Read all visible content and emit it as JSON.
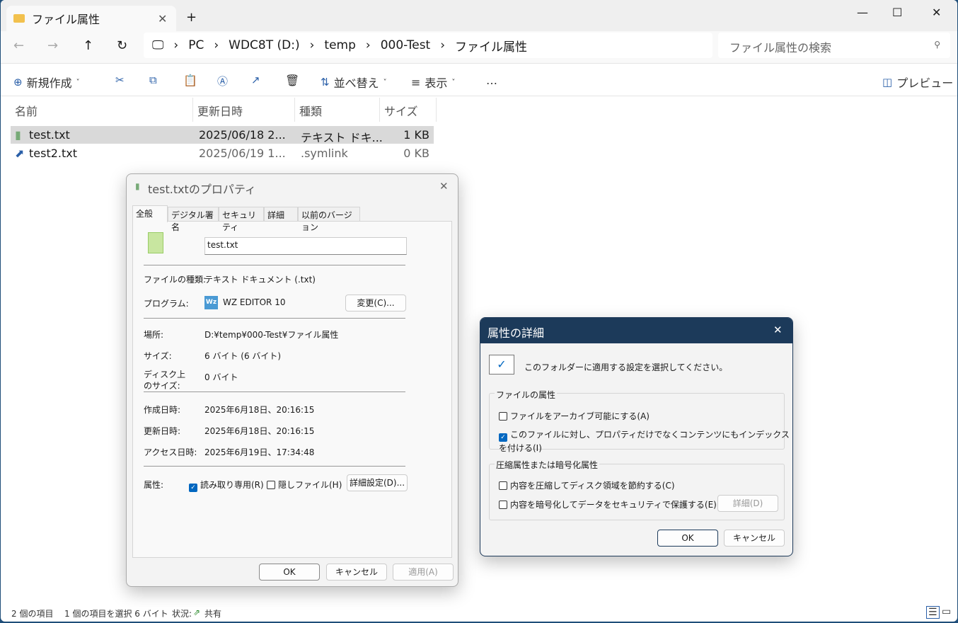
{
  "window": {
    "tab_title": "ファイル属性",
    "new_tab": "+"
  },
  "nav": {
    "back": "←",
    "forward": "→",
    "up": "↑",
    "refresh": "↻",
    "crumbs": [
      "PC",
      "WDC8T (D:)",
      "temp",
      "000-Test",
      "ファイル属性"
    ],
    "search_placeholder": "ファイル属性の検索"
  },
  "toolbar": {
    "new": "新規作成",
    "sort": "並べ替え",
    "view": "表示",
    "more": "…",
    "preview": "プレビュー"
  },
  "columns": [
    "名前",
    "更新日時",
    "種類",
    "サイズ"
  ],
  "files": [
    {
      "name": "test.txt",
      "date": "2025/06/18 2...",
      "type": "テキスト ドキ...",
      "size": "1 KB"
    },
    {
      "name": "test2.txt",
      "date": "2025/06/19 1...",
      "type": ".symlink",
      "size": "0 KB"
    }
  ],
  "status": {
    "count": "2 個の項目",
    "selected": "1 個の項目を選択  6 バイト",
    "state_label": "状況:",
    "state": "共有"
  },
  "props": {
    "title": "test.txtのプロパティ",
    "tabs": [
      "全般",
      "デジタル署名",
      "セキュリティ",
      "詳細",
      "以前のバージョン"
    ],
    "filename": "test.txt",
    "labels": {
      "type": "ファイルの種類:",
      "program": "プログラム:",
      "location": "場所:",
      "size": "サイズ:",
      "disk1": "ディスク上",
      "disk2": "のサイズ:",
      "created": "作成日時:",
      "modified": "更新日時:",
      "accessed": "アクセス日時:",
      "attrs": "属性:"
    },
    "values": {
      "type": "テキスト ドキュメント (.txt)",
      "program": "WZ EDITOR 10",
      "location": "D:¥temp¥000-Test¥ファイル属性",
      "size": "6 バイト (6 バイト)",
      "disk": "0 バイト",
      "created": "2025年6月18日、20:16:15",
      "modified": "2025年6月18日、20:16:15",
      "accessed": "2025年6月19日、17:34:48"
    },
    "change": "変更(C)...",
    "readonly": "読み取り専用(R)",
    "hidden": "隠しファイル(H)",
    "advanced": "詳細設定(D)...",
    "ok": "OK",
    "cancel": "キャンセル",
    "apply": "適用(A)"
  },
  "adv": {
    "title": "属性の詳細",
    "intro": "このフォルダーに適用する設定を選択してください。",
    "group1": "ファイルの属性",
    "archive": "ファイルをアーカイブ可能にする(A)",
    "index": "このファイルに対し、プロパティだけでなくコンテンツにもインデックスを付ける(I)",
    "group2": "圧縮属性または暗号化属性",
    "compress": "内容を圧縮してディスク領域を節約する(C)",
    "encrypt": "内容を暗号化してデータをセキュリティで保護する(E)",
    "details": "詳細(D)",
    "ok": "OK",
    "cancel": "キャンセル"
  }
}
